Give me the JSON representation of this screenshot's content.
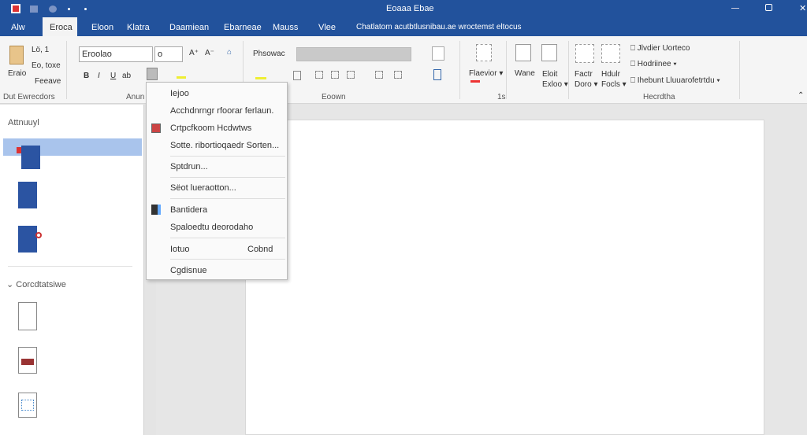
{
  "window": {
    "title": "Eoaaa Ebae",
    "controls": [
      "minimize",
      "maximize",
      "close"
    ]
  },
  "tabs": [
    "Alw",
    "Eroca",
    "Eloon",
    "Klatra",
    "Daamiean",
    "Ebarneae",
    "Mauss",
    "Vlee",
    "Chatlatom acutbtlusnibau.ae wroctemst eltocus"
  ],
  "ribbon": {
    "clipboard": {
      "paste": "Eraio",
      "cut": "Lö, 1",
      "copy": "Eo, toxe",
      "format": "Feeave",
      "group": "Dut Ewrecdors"
    },
    "font": {
      "name": "Eroolao",
      "size": "o",
      "group": "Anun"
    },
    "paragraph": {
      "style": "Phsowac",
      "group": "Eoown"
    },
    "styles": {
      "label": "Flaevior",
      "group": "1s"
    },
    "editing": {
      "b1": "Wane",
      "b2": "Eloit",
      "b2b": "Exloo",
      "b3": "Factr",
      "b3b": "Doro",
      "b4": "Hdulr",
      "b4b": "Focls",
      "r1": "Jlvdier Uorteco",
      "r2": "Hodriinee",
      "r3": "Ihebunt Lluuarofetrtdu",
      "group": "Hecrdtha"
    }
  },
  "left_pane": {
    "section1": "Attnuuyl",
    "section2": "Corcdtatsiwe"
  },
  "menu": {
    "items": [
      "Iejoo",
      "Acchdnrngr rfoorar ferlaun.",
      "Crtpcfkoom Hcdwtws",
      "Sotte. ribortioqaedr Sorten...",
      "Sptdrun...",
      "Sëot lueraotton...",
      "Bantidera",
      "Spaloedtu deorodaho",
      "Iotuo",
      "Cgdisnue"
    ],
    "shortcut": "Cobnd"
  }
}
